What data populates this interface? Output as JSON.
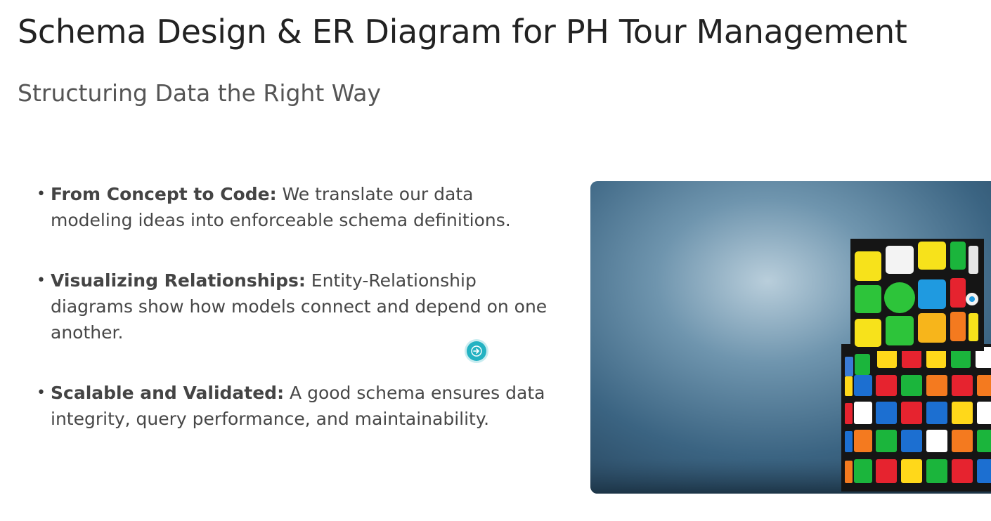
{
  "slide": {
    "title": "Schema Design & ER Diagram for PH Tour Management",
    "subtitle": "Structuring Data the Right Way",
    "bullets": [
      {
        "heading": "From Concept to Code:",
        "text": " We translate our data modeling ideas into enforceable schema definitions."
      },
      {
        "heading": "Visualizing Relationships:",
        "text": " Entity-Relationship diagrams show how models connect and depend on one another."
      },
      {
        "heading": "Scalable and Validated:",
        "text": " A good schema ensures data integrity, query performance, and maintainability."
      }
    ]
  },
  "colors": {
    "image_background": "#3d6a88",
    "cursor": "#23b2c2"
  },
  "icons": {
    "bullet": "bullet-dot",
    "cursor": "arrow-right-icon",
    "image": "rubiks-cube-illustration"
  }
}
